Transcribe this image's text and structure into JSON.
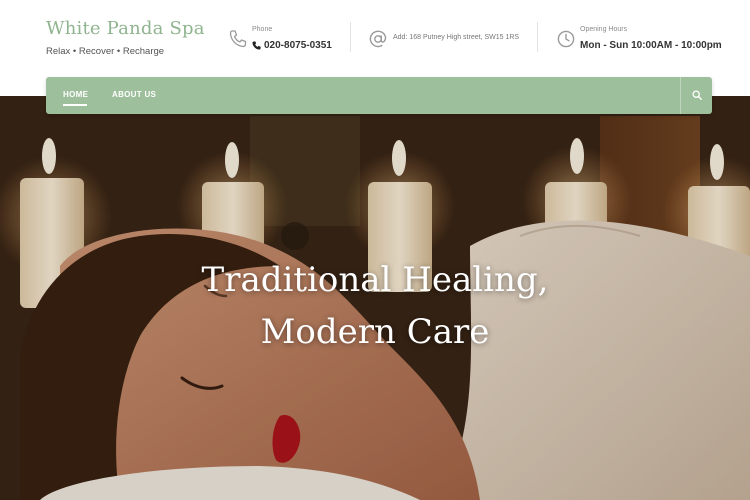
{
  "brand": {
    "title": "White Panda Spa",
    "tagline": "Relax • Recover • Recharge"
  },
  "contact": {
    "phone": {
      "label": "Phone",
      "value": "020-8075-0351",
      "icon": "phone-icon"
    },
    "address": {
      "value": "Add: 168 Putney High street, SW15 1RS",
      "icon": "at-sign-icon"
    },
    "hours": {
      "label": "Opening Hours",
      "value": "Mon - Sun 10:00AM - 10:00pm",
      "icon": "clock-icon"
    }
  },
  "nav": {
    "items": [
      {
        "label": "HOME",
        "active": true
      },
      {
        "label": "ABOUT US",
        "active": false
      }
    ],
    "search_icon": "search-icon"
  },
  "hero": {
    "line1": "Traditional Healing,",
    "line2": "Modern Care"
  },
  "colors": {
    "brand_green": "#8fb48f",
    "nav_green": "#9dbf9c",
    "text_dark": "#333333"
  }
}
